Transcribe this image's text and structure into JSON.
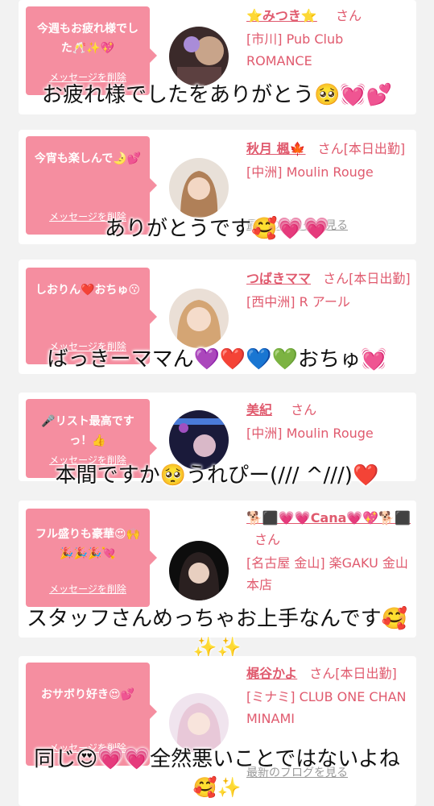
{
  "delete_label": "メッセージを削除",
  "blog_label": "最新のブログを見る",
  "san_label": "さん",
  "cards": [
    {
      "message": "今週もお疲れ様でした🥂✨💖",
      "name": "⭐みつき⭐",
      "san": "さん",
      "shop": "[市川] Pub Club ROMANCE",
      "caption": "お疲れ様でしたをありがとう🥺💓💕"
    },
    {
      "message": "今宵も楽しんで🌛💕",
      "name": "秋月 楓🍁",
      "san": "さん[本日出勤]",
      "shop": "[中洲] Moulin Rouge",
      "caption": "ありがとうです🥰💗💗"
    },
    {
      "message": "しおりん❤️おちゅ😗",
      "name": "つばきママ",
      "san": "さん[本日出勤]",
      "shop": "[西中洲] R アール",
      "caption": "ばっきーママん💜❤️💙💚おちゅ💓"
    },
    {
      "message": "🎤リスト最高ですっ！👍",
      "name": "美紀",
      "san": "さん",
      "shop": "[中洲] Moulin Rouge",
      "caption": "本間ですか🥺うれぴー(/// ^///)❤️"
    },
    {
      "message": "フル盛りも豪華😍🙌🎉🎉🎉💘",
      "name": "🐕⬛💗💗Cana💗💖🐕⬛",
      "san": "さん",
      "shop": "[名古屋 金山] 楽GAKU 金山本店",
      "caption": "スタッフさんめっちゃお上手なんです🥰",
      "caption_line2": "✨✨"
    },
    {
      "message": "おサボり好き😍💕",
      "name": "梶谷かよ",
      "san": "さん[本日出勤]",
      "shop": "[ミナミ] CLUB ONE CHAN MINAMI",
      "caption": "同じ😍💗💗全然悪いことではないよね",
      "caption_line2": "🥰✨"
    }
  ]
}
